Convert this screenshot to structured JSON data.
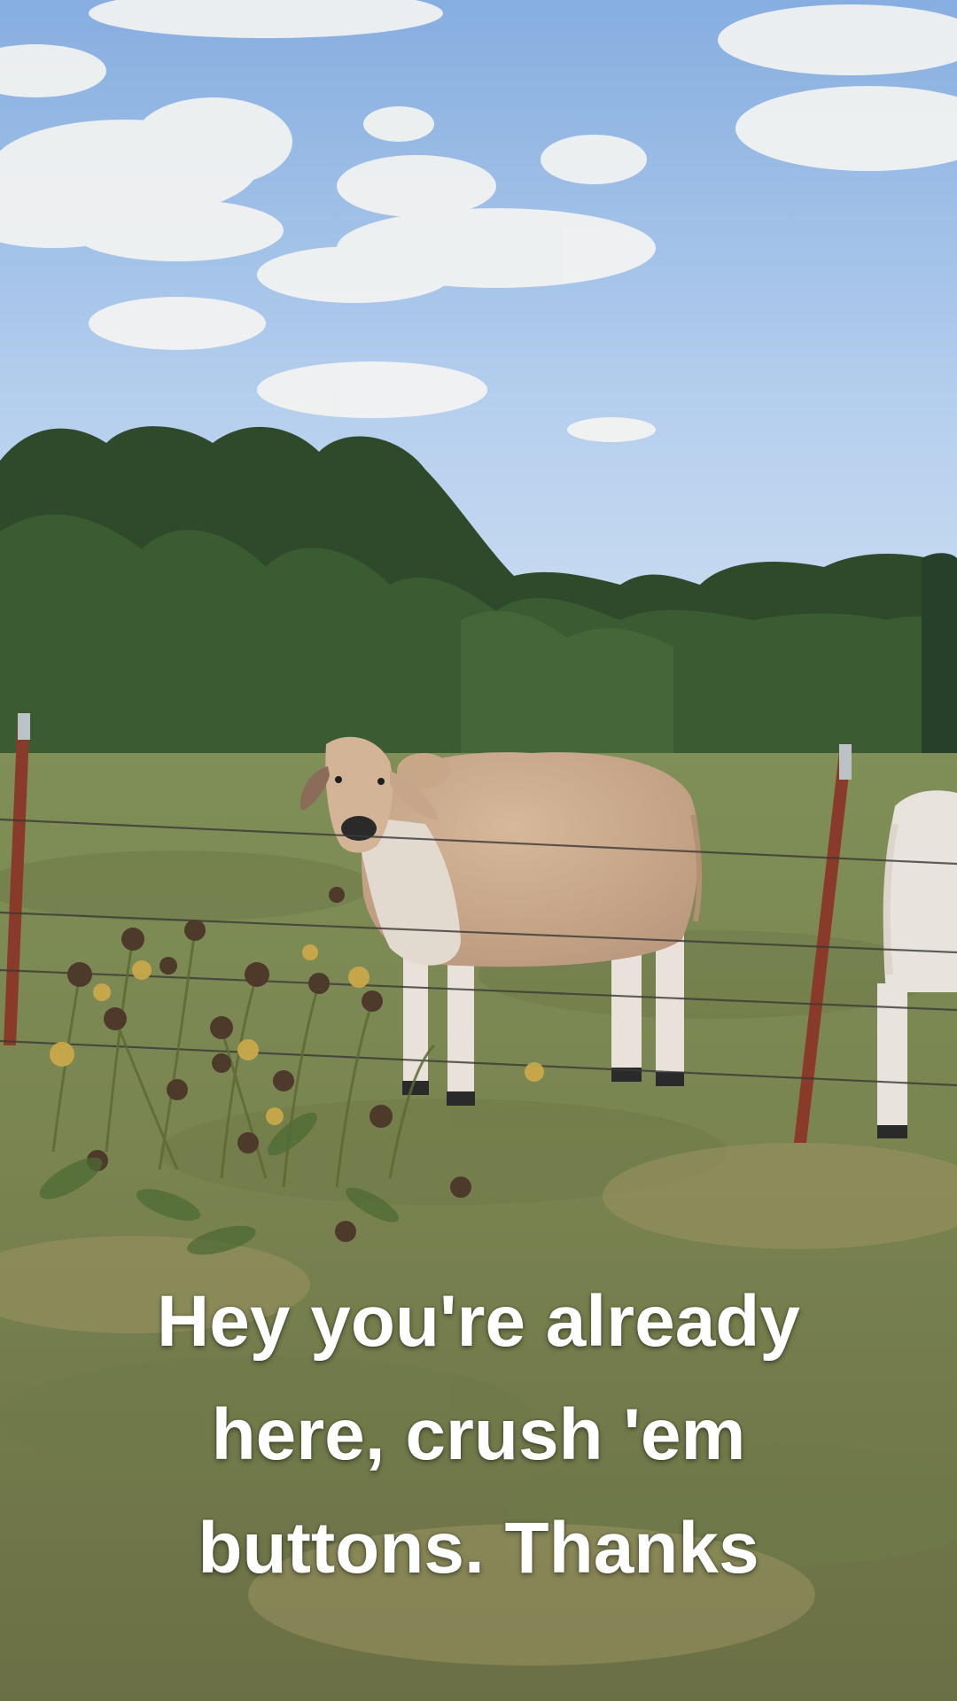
{
  "caption": {
    "lines": [
      "Hey you're already",
      "here, crush 'em",
      "buttons. Thanks"
    ]
  },
  "scene": {
    "description_tags": [
      "sky",
      "clouds",
      "trees",
      "pasture",
      "barbed-wire-fence",
      "cow",
      "wildflowers"
    ],
    "colors": {
      "sky_top": "#8fb6e3",
      "sky_bottom": "#c9ddf0",
      "tree_dark": "#2f4a2a",
      "tree_mid": "#3f5f33",
      "grass": "#7f8b55",
      "cow_body": "#c9a88a",
      "cow_white": "#e6e1da",
      "fence_post": "#8a3a2a"
    }
  }
}
